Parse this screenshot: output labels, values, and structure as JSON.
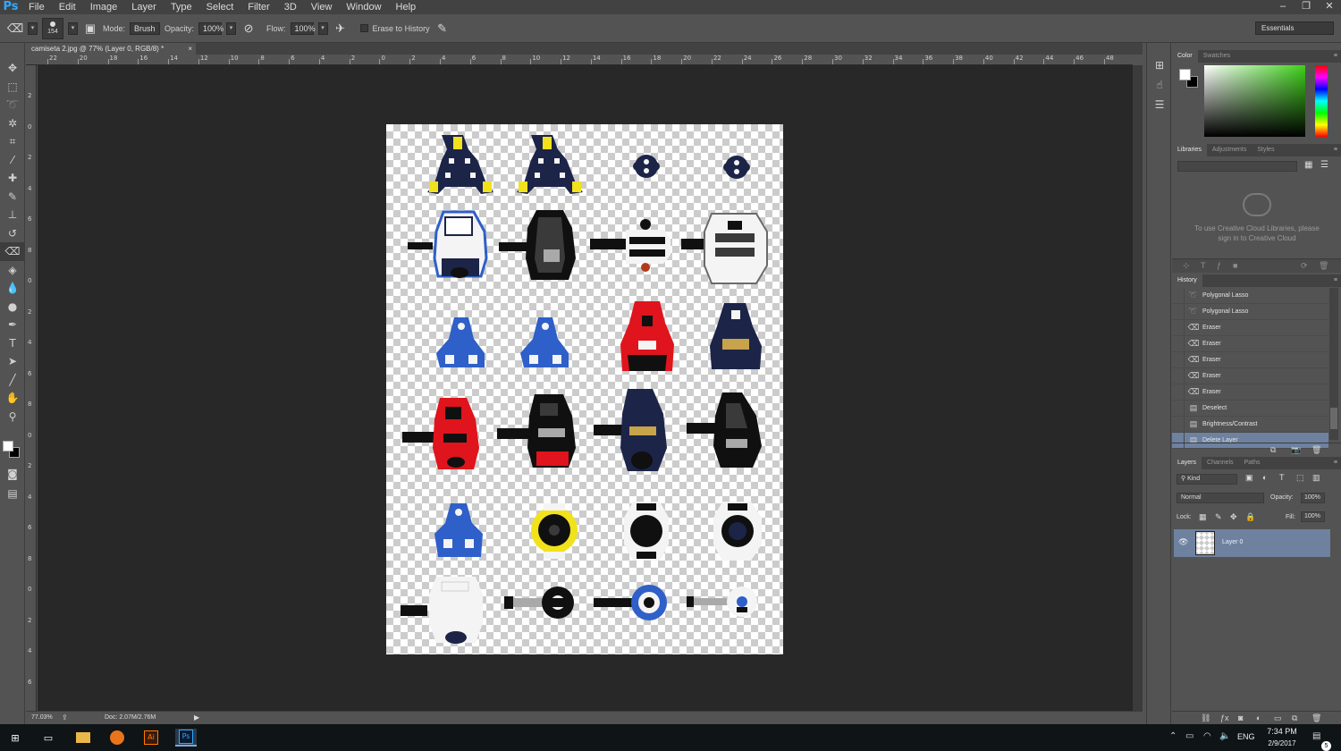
{
  "app": {
    "logo": "Ps",
    "name": "Adobe Photoshop"
  },
  "menu": {
    "items": [
      "File",
      "Edit",
      "Image",
      "Layer",
      "Type",
      "Select",
      "Filter",
      "3D",
      "View",
      "Window",
      "Help"
    ]
  },
  "window_controls": {
    "minimize": "–",
    "restore": "❐",
    "close": "✕"
  },
  "options_bar": {
    "tool_icon": "eraser-icon",
    "brush_size": "154",
    "mode_label": "Mode:",
    "mode_value": "Brush",
    "opacity_label": "Opacity:",
    "opacity_value": "100%",
    "flow_label": "Flow:",
    "flow_value": "100%",
    "erase_to_history_label": "Erase to History",
    "erase_to_history_checked": false,
    "workspace": "Essentials"
  },
  "document": {
    "tab_title": "camiseta 2.jpg @ 77% (Layer 0, RGB/8) *",
    "tab_close": "×",
    "ruler_h_labels": [
      "22",
      "20",
      "18",
      "16",
      "14",
      "12",
      "10",
      "8",
      "6",
      "4",
      "2",
      "0",
      "2",
      "4",
      "6",
      "8",
      "10",
      "12",
      "14",
      "16",
      "18",
      "20",
      "22",
      "24",
      "26",
      "28",
      "30",
      "32",
      "34",
      "36",
      "38",
      "40",
      "42",
      "44",
      "46",
      "48"
    ],
    "ruler_v_labels": [
      "2",
      "0",
      "2",
      "4",
      "6",
      "8",
      "0",
      "2",
      "4",
      "6",
      "8",
      "0",
      "2",
      "4",
      "6",
      "8",
      "0",
      "2",
      "4",
      "6"
    ],
    "zoom": "77.03%",
    "doc_size": "Doc: 2.07M/2.76M",
    "content": "clipless bicycle pedals and cleats on transparent background",
    "pedal_colors": {
      "navy": "#1c2448",
      "yellow": "#f1e21c",
      "red": "#e0141c",
      "blue": "#2f5fc8",
      "white": "#f4f4f4",
      "black": "#101010",
      "silver": "#a9a9a9"
    }
  },
  "tools": [
    "move",
    "marquee",
    "lasso",
    "quick-select",
    "crop",
    "eyedropper",
    "healing",
    "brush",
    "stamp",
    "history-brush",
    "eraser",
    "fill",
    "blur",
    "dodge",
    "pen",
    "type",
    "path-select",
    "line",
    "hand",
    "zoom"
  ],
  "panels": {
    "color": {
      "tabs": [
        "Color",
        "Swatches"
      ],
      "accent": "#3ed11a"
    },
    "libraries": {
      "tabs": [
        "Libraries",
        "Adjustments",
        "Styles"
      ],
      "message": "To use Creative Cloud Libraries, please sign in to Creative Cloud"
    },
    "history": {
      "title": "History",
      "items": [
        {
          "label": "Polygonal Lasso",
          "icon": "lasso-icon",
          "selected": false
        },
        {
          "label": "Polygonal Lasso",
          "icon": "lasso-icon",
          "selected": false
        },
        {
          "label": "Eraser",
          "icon": "eraser-icon",
          "selected": false
        },
        {
          "label": "Eraser",
          "icon": "eraser-icon",
          "selected": false
        },
        {
          "label": "Eraser",
          "icon": "eraser-icon",
          "selected": false
        },
        {
          "label": "Eraser",
          "icon": "eraser-icon",
          "selected": false
        },
        {
          "label": "Eraser",
          "icon": "eraser-icon",
          "selected": false
        },
        {
          "label": "Deselect",
          "icon": "document-icon",
          "selected": false
        },
        {
          "label": "Brightness/Contrast",
          "icon": "document-icon",
          "selected": false
        },
        {
          "label": "Delete Layer",
          "icon": "document-icon",
          "selected": true
        }
      ]
    },
    "layers": {
      "tabs": [
        "Layers",
        "Channels",
        "Paths"
      ],
      "filter_kind": "Kind",
      "blend_mode": "Normal",
      "opacity_label": "Opacity:",
      "opacity_value": "100%",
      "lock_label": "Lock:",
      "fill_label": "Fill:",
      "fill_value": "100%",
      "layer_name": "Layer 0"
    }
  },
  "taskbar": {
    "language": "ENG",
    "time": "7:34 PM",
    "date": "2/9/2017",
    "notifications": "5"
  }
}
